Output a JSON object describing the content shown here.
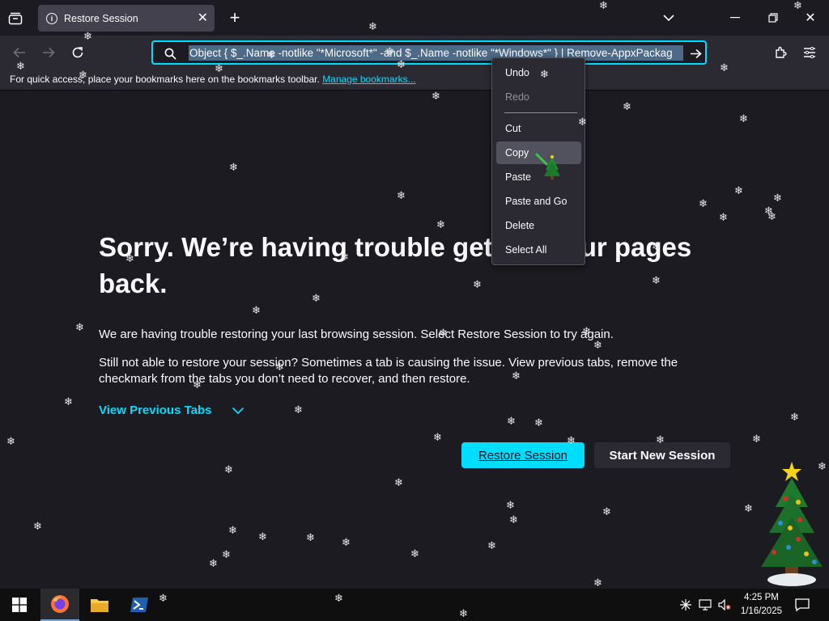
{
  "tab": {
    "title": "Restore Session"
  },
  "url": {
    "value": "Object { $_.Name -notlike \"*Microsoft*\" -and $_.Name -notlike \"*Windows*\" } | Remove-AppxPackag"
  },
  "bookmarks_bar": {
    "text": "For quick access, place your bookmarks here on the bookmarks toolbar. ",
    "link": "Manage bookmarks..."
  },
  "page": {
    "title": "Sorry. We’re having trouble getting your pages back.",
    "para1": "We are having trouble restoring your last browsing session. Select Restore Session to try again.",
    "para2": "Still not able to restore your session? Sometimes a tab is causing the issue. View previous tabs, remove the checkmark from the tabs you don’t need to recover, and then restore.",
    "view_previous": "View Previous Tabs",
    "restore_button": "Restore Session",
    "new_session_button": "Start New Session"
  },
  "context_menu": {
    "undo": "Undo",
    "redo": "Redo",
    "cut": "Cut",
    "copy": "Copy",
    "paste": "Paste",
    "paste_go": "Paste and Go",
    "delete": "Delete",
    "select_all": "Select All"
  },
  "taskbar": {
    "time": "4:25 PM",
    "date": "1/16/2025"
  },
  "colors": {
    "accent": "#00ddff",
    "background": "#1c1b22",
    "toolbar": "#2b2a33",
    "menu_hover": "#52525e"
  }
}
